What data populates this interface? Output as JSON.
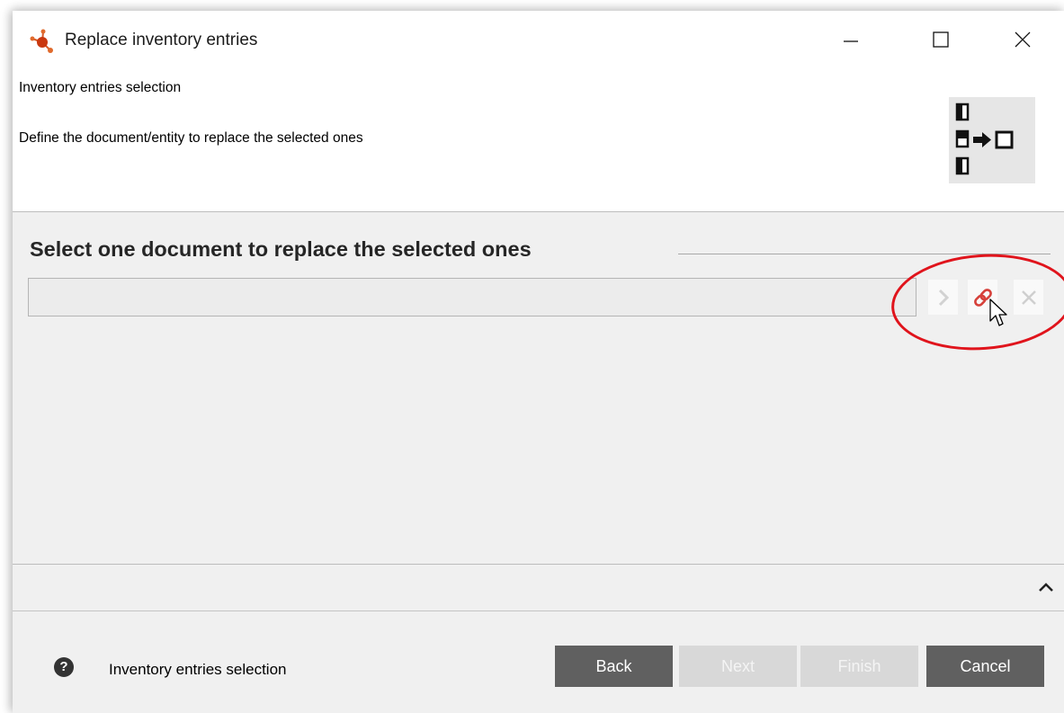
{
  "window": {
    "title": "Replace inventory entries",
    "icons": {
      "app": "app-molecule-icon",
      "minimize": "minimize-icon",
      "maximize": "maximize-icon",
      "close": "close-icon"
    }
  },
  "header": {
    "title": "Inventory entries selection",
    "description": "Define the document/entity to replace the selected ones",
    "icon": "replace-document-icon"
  },
  "selection": {
    "group_title": "Select one document to replace the selected ones",
    "document_value": "",
    "buttons": {
      "go": "chevron-right-icon",
      "link": "link-icon",
      "clear": "clear-x-icon"
    }
  },
  "details": {
    "expand_icon": "chevron-up-icon"
  },
  "footer": {
    "help_glyph": "?",
    "status_text": "Inventory entries selection",
    "buttons": {
      "back": "Back",
      "next": "Next",
      "finish": "Finish",
      "cancel": "Cancel"
    }
  },
  "colors": {
    "highlight": "#e0141c",
    "link_icon": "#d6403a",
    "button_dark": "#606060",
    "button_disabled": "#d8d8d8"
  }
}
